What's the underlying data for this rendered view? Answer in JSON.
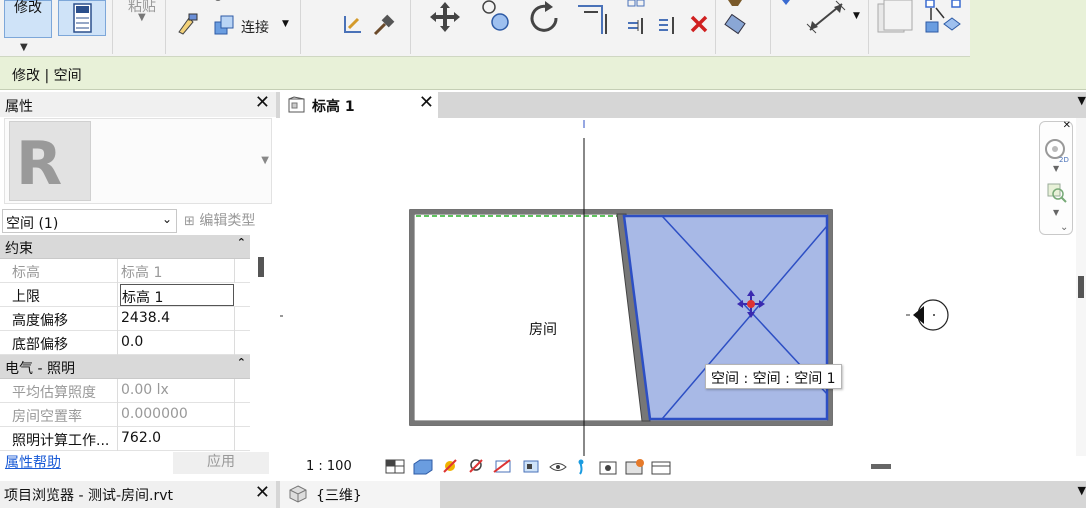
{
  "ribbon": {
    "modify_label": "修改",
    "paste_label": "粘贴",
    "connect_label": "连接"
  },
  "context_bar": {
    "label": "修改 | 空间"
  },
  "properties": {
    "title": "属性",
    "instance_selector": "空间 (1)",
    "edit_type_label": "编辑类型",
    "sections": [
      {
        "title": "约束",
        "rows": [
          {
            "name": "标高",
            "value": "标高 1"
          },
          {
            "name": "上限",
            "value": "标高 1"
          },
          {
            "name": "高度偏移",
            "value": "2438.4"
          },
          {
            "name": "底部偏移",
            "value": "0.0"
          }
        ]
      },
      {
        "title": "电气 - 照明",
        "rows": [
          {
            "name": "平均估算照度",
            "value": "0.00 lx"
          },
          {
            "name": "房间空置率",
            "value": "0.000000"
          },
          {
            "name": "照明计算工作...",
            "value": "762.0"
          }
        ]
      }
    ],
    "help_link": "属性帮助",
    "apply_button": "应用"
  },
  "view_tab": {
    "title": "标高 1"
  },
  "canvas": {
    "room_label": "房间",
    "tooltip": "空间 : 空间 : 空间 1",
    "space_fill_color": "#a8b9e6",
    "space_stroke_color": "#2d4fc4"
  },
  "view_control": {
    "scale": "1 : 100"
  },
  "project_browser": {
    "title": "项目浏览器 - 测试-房间.rvt"
  },
  "view_tab_3d": {
    "title": "{三维}"
  }
}
